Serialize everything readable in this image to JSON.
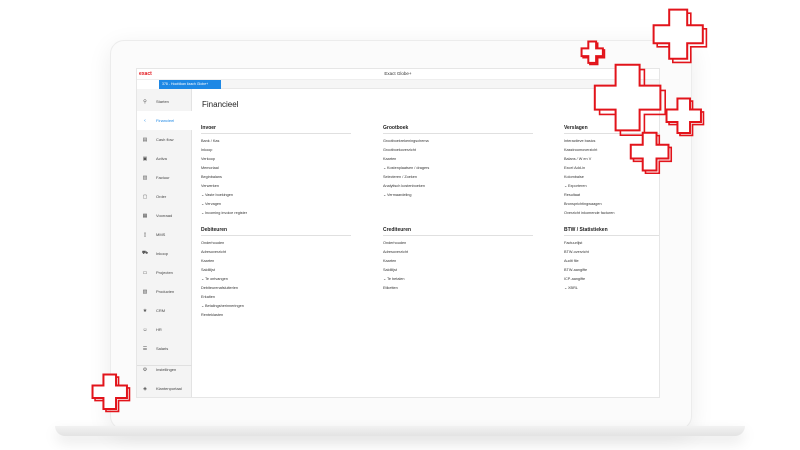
{
  "app": {
    "logo": "exact",
    "title": "Exact Globe+"
  },
  "environment_tab": "378 - Hoofdkan lizach Globe+",
  "sidebar": {
    "items": [
      {
        "label": "Starten",
        "icon": "search-icon"
      },
      {
        "label": "Financieel",
        "icon": "chevron-left-icon",
        "active": true
      },
      {
        "label": "Cash flow",
        "icon": "cashflow-icon"
      },
      {
        "label": "Activa",
        "icon": "briefcase-icon"
      },
      {
        "label": "Factuur",
        "icon": "invoice-icon"
      },
      {
        "label": "Order",
        "icon": "order-icon"
      },
      {
        "label": "Voorraad",
        "icon": "stock-icon"
      },
      {
        "label": "MMS",
        "icon": "document-icon"
      },
      {
        "label": "Inkoop",
        "icon": "cart-icon"
      },
      {
        "label": "Projecten",
        "icon": "folder-icon"
      },
      {
        "label": "Producten",
        "icon": "box-icon"
      },
      {
        "label": "CRM",
        "icon": "star-icon"
      },
      {
        "label": "HR",
        "icon": "people-icon"
      },
      {
        "label": "Salaris",
        "icon": "salary-icon"
      }
    ],
    "bottom_items": [
      {
        "label": "Instellingen",
        "icon": "gear-icon"
      },
      {
        "label": "Klantenportaal",
        "icon": "shield-icon"
      }
    ]
  },
  "main": {
    "title": "Financieel",
    "sections": [
      {
        "title": "Invoer",
        "links": [
          {
            "label": "Bank / Kas"
          },
          {
            "label": "Inkoop"
          },
          {
            "label": "Verkoop"
          },
          {
            "label": "Memoriaal"
          },
          {
            "label": "Beginbalans"
          },
          {
            "label": "Verwerken"
          },
          {
            "label": "Vaste boekingen",
            "chevron": true
          },
          {
            "label": "Vervagen",
            "chevron": true
          },
          {
            "label": "Incoming invoice register",
            "chevron": true
          }
        ]
      },
      {
        "title": "Grootboek",
        "links": [
          {
            "label": "Grootboekrekeningschema"
          },
          {
            "label": "Grootboekoverzicht"
          },
          {
            "label": "Kaarten"
          },
          {
            "label": "Kostenplaatsen / dragers",
            "chevron": true
          },
          {
            "label": "Selecteren / Zoeken"
          },
          {
            "label": "Analytisch kostenboeken"
          },
          {
            "label": "Vermaardeling",
            "chevron": true
          }
        ]
      },
      {
        "title": "Verslagen",
        "links": [
          {
            "label": "Interactieve basics"
          },
          {
            "label": "Kasstroomoverzicht"
          },
          {
            "label": "Balans / W en V"
          },
          {
            "label": "Excel Add-in"
          },
          {
            "label": "Kolombalse"
          },
          {
            "label": "Exporteren",
            "chevron": true
          },
          {
            "label": "Resultaat"
          },
          {
            "label": "Bronsprichtingwaagen"
          },
          {
            "label": "Overzicht inkomende facturen"
          }
        ]
      },
      {
        "title": "Debiteuren",
        "links": [
          {
            "label": "Onderhouden"
          },
          {
            "label": "Adresoverzicht"
          },
          {
            "label": "Kaarten"
          },
          {
            "label": "Saldilijst"
          },
          {
            "label": "Te ontvangen",
            "chevron": true
          },
          {
            "label": "Debiteurenafsluiterlen"
          },
          {
            "label": "Erkalten"
          },
          {
            "label": "Betalingsherinneringen",
            "chevron": true
          },
          {
            "label": "Renteklasten"
          }
        ]
      },
      {
        "title": "Crediteuren",
        "links": [
          {
            "label": "Onderhouden"
          },
          {
            "label": "Adresoverzicht"
          },
          {
            "label": "Kaarten"
          },
          {
            "label": "Saldilijst"
          },
          {
            "label": "Te betalen",
            "chevron": true
          },
          {
            "label": "Etiketten"
          }
        ]
      },
      {
        "title": "BTW / Statistieken",
        "links": [
          {
            "label": "Factuurlijst"
          },
          {
            "label": "BTW-overzicht"
          },
          {
            "label": "Audit file"
          },
          {
            "label": "BTW-aangifte"
          },
          {
            "label": "ICP-aangifte"
          },
          {
            "label": "XBRL",
            "chevron": true
          }
        ]
      }
    ]
  },
  "colors": {
    "accent": "#1e88e5",
    "brand": "#e2141b"
  }
}
